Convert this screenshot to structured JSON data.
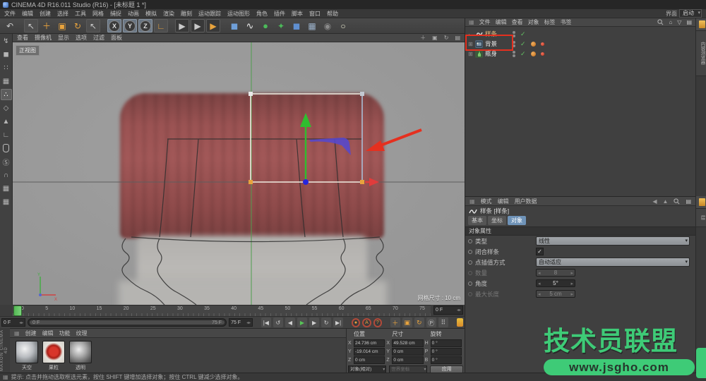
{
  "window": {
    "title": "CINEMA 4D R16.011 Studio (R16) - [未标题 1 *]"
  },
  "menu_bar": {
    "items": [
      "文件",
      "编辑",
      "创建",
      "选择",
      "工具",
      "网格",
      "捕捉",
      "动画",
      "模拟",
      "渲染",
      "雕刻",
      "运动跟踪",
      "运动图形",
      "角色",
      "插件",
      "脚本",
      "窗口",
      "帮助"
    ],
    "layout_label": "界面",
    "layout_value": "启动"
  },
  "toolbar": {
    "x": "X",
    "y": "Y",
    "z": "Z"
  },
  "icons": {
    "undo": "↶",
    "cursor": "↖",
    "move": "＋",
    "scale": "▣",
    "rotate": "↻",
    "coord": "∟",
    "render": "▶",
    "cube": "◼",
    "spline": "∿",
    "generator": "●",
    "deformer": "✦",
    "instance": "◼",
    "floor": "▦",
    "camera": "◉",
    "light": "○",
    "convert": "↯",
    "model": "◼",
    "texture_axis": "∷",
    "texture": "▦",
    "points": "∴",
    "edges": "◇",
    "polygons": "▲",
    "axis": "∟",
    "snap": "Ⓢ",
    "magnet": "∩",
    "workplane": "▦",
    "home": "⌂",
    "funnel": "▽",
    "panel": "▤",
    "play_start": "|◀",
    "loop": "↺",
    "prev": "◀",
    "play": "▶",
    "next": "▶",
    "repeat": "↻",
    "play_end": "▶|",
    "dots": "⠿",
    "grid_menu": "▦",
    "left_arrow": "◀",
    "up_arrow": "▲",
    "check": "✓"
  },
  "viewport": {
    "menu": [
      "查看",
      "摄像机",
      "显示",
      "选项",
      "过滤",
      "面板"
    ],
    "view_label": "正视图",
    "grid_size": "网格尺寸 : 10 cm",
    "axis_x": "X",
    "axis_y": "Y"
  },
  "timeline": {
    "ticks": [
      "0",
      "5",
      "10",
      "15",
      "20",
      "25",
      "30",
      "35",
      "40",
      "45",
      "50",
      "55",
      "60",
      "65",
      "70",
      "75"
    ],
    "ruler_frame": "0 F",
    "start_field": "0 F",
    "slider_start_label": "0 F",
    "slider_end_label": "75 F",
    "end_field": "75 F"
  },
  "object_manager": {
    "menu": [
      "文件",
      "编辑",
      "查看",
      "对象",
      "标签",
      "书签"
    ],
    "objects": [
      {
        "name": "样条"
      },
      {
        "name": "背景"
      },
      {
        "name": "瓶身"
      }
    ]
  },
  "attributes": {
    "menu": [
      "模式",
      "编辑",
      "用户数据"
    ],
    "object_title": "样条 [样条]",
    "tabs": [
      "基本",
      "坐标",
      "对象"
    ],
    "active_tab": "对象",
    "section": "对象属性",
    "fields": {
      "type_label": "类型",
      "type_value": "线性",
      "close_label": "闭合样条",
      "close_checked": "✓",
      "interp_label": "点插值方式",
      "interp_value": "自动适应",
      "count_label": "数量",
      "count_value": "8",
      "angle_label": "角度",
      "angle_value": "5°",
      "maxlen_label": "最大长度",
      "maxlen_value": "5 cm"
    }
  },
  "coordinates": {
    "headers": [
      "位置",
      "尺寸",
      "旋转"
    ],
    "position": {
      "x_label": "X",
      "x": "24.736 cm",
      "y_label": "Y",
      "y": "-19.014 cm",
      "z_label": "Z",
      "z": "0 cm"
    },
    "size": {
      "x_label": "X",
      "x": "49.528 cm",
      "y_label": "Y",
      "y": "0 cm",
      "z_label": "Z",
      "z": "0 cm"
    },
    "rotation": {
      "h_label": "H",
      "h": "0 °",
      "p_label": "P",
      "p": "0 °",
      "b_label": "B",
      "b": "0 °"
    },
    "footer": {
      "space": "对象(相对)",
      "axis": "世界坐标",
      "apply": "应用"
    }
  },
  "materials": {
    "menu": [
      "创建",
      "编辑",
      "功能",
      "纹理"
    ],
    "items": [
      {
        "name": "天空"
      },
      {
        "name": "果粒"
      },
      {
        "name": "透明"
      }
    ]
  },
  "brand": {
    "vertical": "MAXON CINEMA 4D"
  },
  "status_bar": {
    "text": "提示: 点击并拖动选取框选元素，按住 SHIFT 键增加选择对象；按住 CTRL 键减少选择对象。"
  },
  "watermark": {
    "title": "技术员联盟",
    "url": "www.jsgho.com"
  },
  "side_tabs": {
    "top": "内容浏览器",
    "bottom": "层"
  },
  "colors": {
    "accent_orange": "#e8a33d",
    "annotation_red": "#e5301f",
    "axis_green": "#2fbe2f",
    "axis_red": "#e03c3c",
    "origin_blue": "#2626dd",
    "watermark_green": "#3ecb77",
    "viewport_bg": "#9c9c9c",
    "cap_red": "#9c5252"
  }
}
